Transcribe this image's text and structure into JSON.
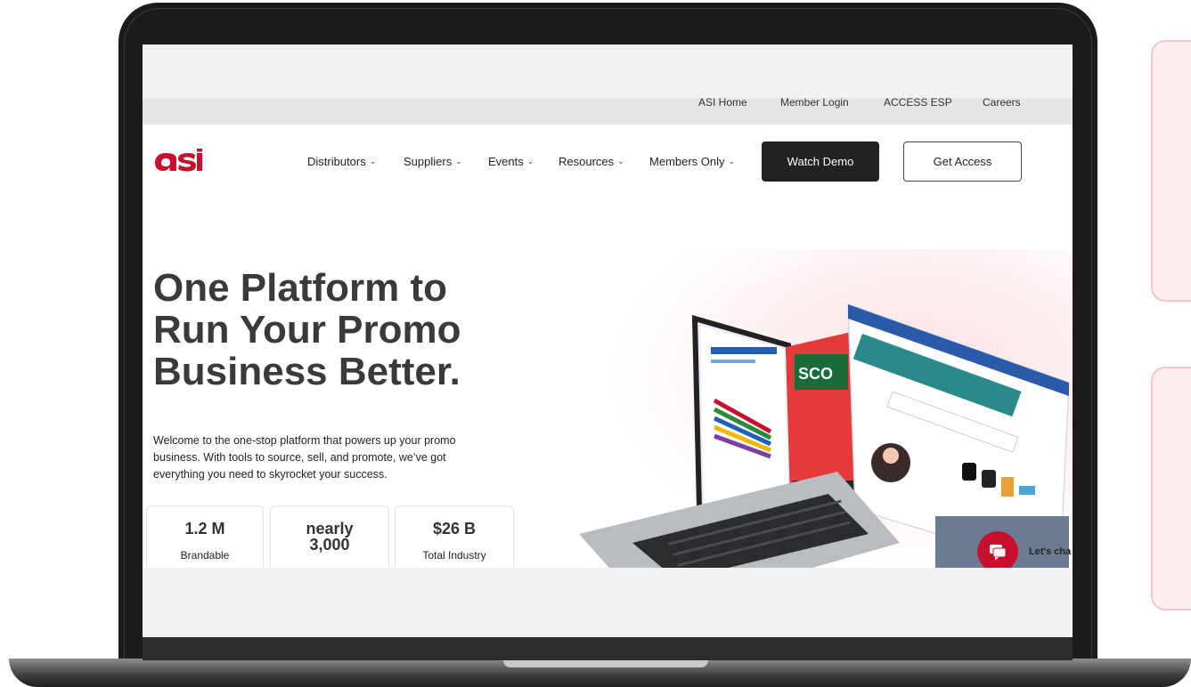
{
  "utility_nav": [
    "ASI Home",
    "Member Login",
    "ACCESS ESP",
    "Careers"
  ],
  "main_nav": [
    "Distributors",
    "Suppliers",
    "Events",
    "Resources",
    "Members Only"
  ],
  "cta": {
    "watch_demo": "Watch Demo",
    "get_access": "Get Access"
  },
  "hero": {
    "title_lines": [
      "One Platform to",
      "Run Your Promo",
      "Business Better."
    ],
    "description": "Welcome to the one-stop platform that powers up your promo business. With tools to source, sell, and promote, we’ve got everything you need to skyrocket your success."
  },
  "stats": [
    {
      "value": "1.2 M",
      "label": "Brandable"
    },
    {
      "value": "nearly\n3,000",
      "label": ""
    },
    {
      "value": "$26 B",
      "label": "Total Industry"
    }
  ],
  "chat": {
    "label": "Let's cha"
  },
  "colors": {
    "brand_red": "#c8102e",
    "dark_button": "#222222",
    "side_card_bg": "#fdeff0"
  },
  "icons": {
    "chevron": "chevron-down-icon",
    "chat": "chat-bubble-icon",
    "logo": "asi-logo"
  }
}
